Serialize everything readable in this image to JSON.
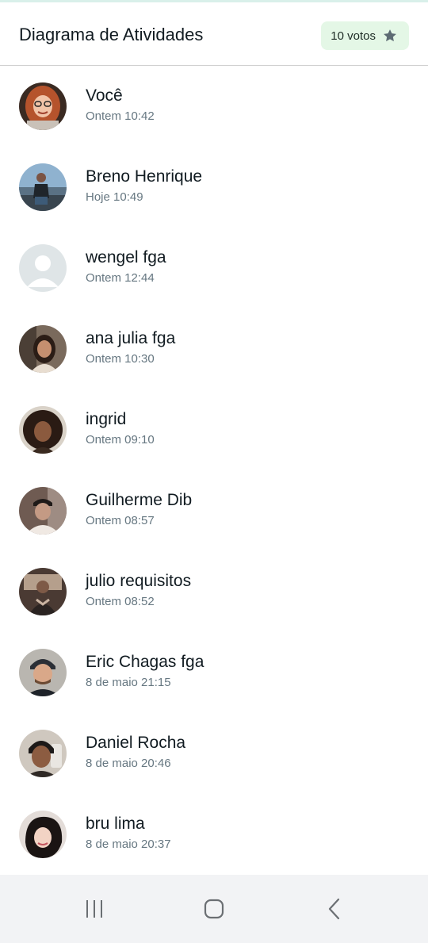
{
  "header": {
    "title": "Diagrama de Atividades",
    "votes_label": "10 votos",
    "votes_icon": "star-icon"
  },
  "colors": {
    "votes_badge_bg": "#e4f7e6",
    "star": "#5d6b73",
    "secondary_text": "#667781",
    "navbar_bg": "#f2f3f5"
  },
  "voters": [
    {
      "name": "Você",
      "time": "Ontem 10:42",
      "avatar": "photo"
    },
    {
      "name": "Breno Henrique",
      "time": "Hoje 10:49",
      "avatar": "photo"
    },
    {
      "name": "wengel fga",
      "time": "Ontem 12:44",
      "avatar": "default-avatar-icon"
    },
    {
      "name": "ana julia fga",
      "time": "Ontem 10:30",
      "avatar": "photo"
    },
    {
      "name": "ingrid",
      "time": "Ontem 09:10",
      "avatar": "photo"
    },
    {
      "name": "Guilherme Dib",
      "time": "Ontem 08:57",
      "avatar": "photo"
    },
    {
      "name": "julio requisitos",
      "time": "Ontem 08:52",
      "avatar": "photo"
    },
    {
      "name": "Eric Chagas fga",
      "time": "8 de maio 21:15",
      "avatar": "photo"
    },
    {
      "name": "Daniel Rocha",
      "time": "8 de maio 20:46",
      "avatar": "photo"
    },
    {
      "name": "bru lima",
      "time": "8 de maio 20:37",
      "avatar": "photo"
    }
  ],
  "navbar": {
    "buttons": [
      "recent-apps-icon",
      "home-icon",
      "back-icon"
    ]
  }
}
